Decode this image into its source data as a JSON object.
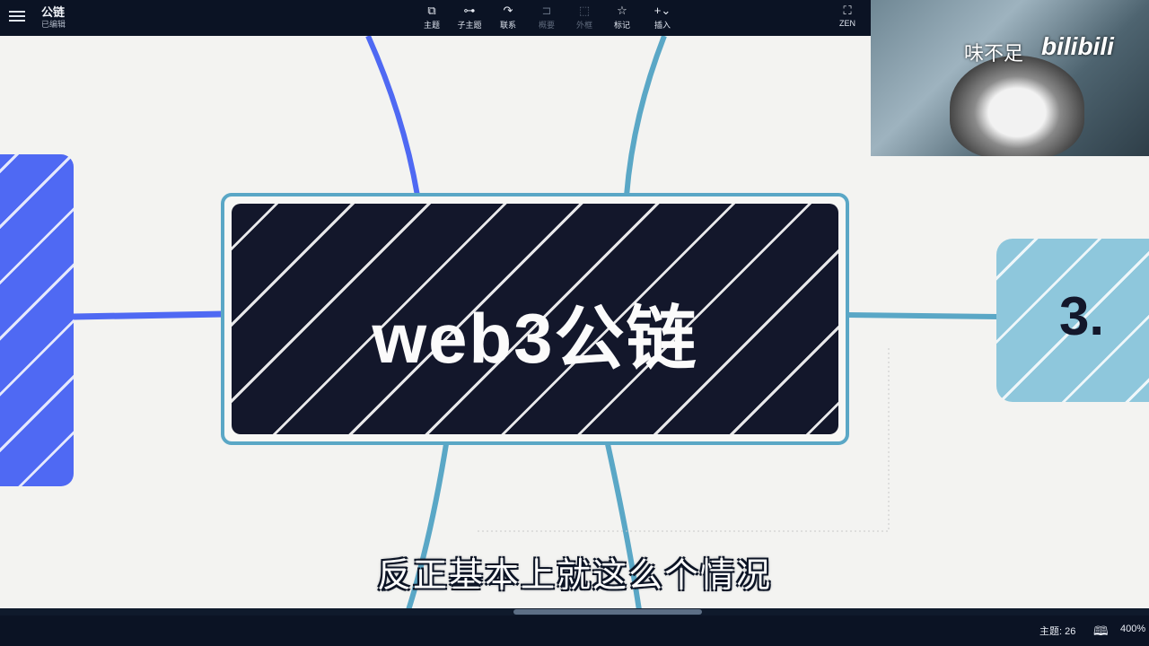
{
  "app": {
    "title": "公链",
    "status": "已编辑"
  },
  "toolbar": {
    "items": [
      {
        "label": "主题",
        "icon": "topic-icon",
        "glyph": "⧉"
      },
      {
        "label": "子主题",
        "icon": "subtopic-icon",
        "glyph": "⊶"
      },
      {
        "label": "联系",
        "icon": "relationship-icon",
        "glyph": "↷"
      },
      {
        "label": "概要",
        "icon": "summary-icon",
        "glyph": "⊐"
      },
      {
        "label": "外框",
        "icon": "boundary-icon",
        "glyph": "⬚"
      },
      {
        "label": "标记",
        "icon": "marker-star-icon",
        "glyph": "☆"
      },
      {
        "label": "插入",
        "icon": "insert-plus-icon",
        "glyph": "+⌄"
      }
    ],
    "zen_label": "ZEN",
    "zen_glyph": "⛶"
  },
  "mindmap": {
    "central_topic": "web3公链",
    "right_topic": "3.",
    "branch_colors": {
      "blue": "#4f69f3",
      "teal": "#5aa7c6",
      "central_fill": "#13172b"
    }
  },
  "subtitle": "反正基本上就这么个情况",
  "video": {
    "overlay_text": "味不足",
    "logo_text": "bilibili"
  },
  "statusbar": {
    "topic_count": "主题: 26",
    "book_glyph": "🕮",
    "zoom": "400%"
  }
}
